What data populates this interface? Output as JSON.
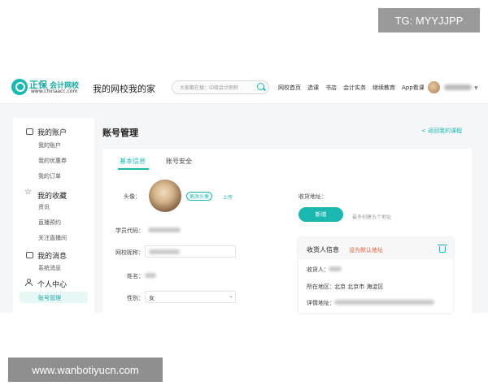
{
  "watermarks": {
    "top": "TG: MYYJJPP",
    "bottom": "www.wanbotiyucn.com"
  },
  "header": {
    "logo_brand": "正保",
    "logo_name": "会计网校",
    "logo_url": "www.chinaacc.com",
    "site_title": "我的网校我的家",
    "search_placeholder": "大家都在搜：中级会计职称",
    "nav": [
      "网校首页",
      "选课",
      "书店",
      "会计实务",
      "继续教育",
      "App看课"
    ]
  },
  "sidebar": {
    "sections": [
      {
        "title": "我的账户",
        "icon": "wallet-icon",
        "items": [
          "我的账户",
          "我的优惠券",
          "我的订单"
        ]
      },
      {
        "title": "我的收藏",
        "icon": "star-icon",
        "items": [
          "资讯",
          "直播预约",
          "关注直播间"
        ]
      },
      {
        "title": "我的消息",
        "icon": "message-icon",
        "items": [
          "系统消息"
        ]
      },
      {
        "title": "个人中心",
        "icon": "user-icon",
        "items": [
          "账号管理"
        ]
      }
    ]
  },
  "main": {
    "title": "账号管理",
    "back_link": "< 返回我的课程",
    "tabs": [
      "基本信息",
      "账号安全"
    ],
    "form": {
      "avatar_label": "头像：",
      "change_avatar": "更改头像",
      "upload": "上传",
      "student_code_label": "学员代码：",
      "nickname_label": "网校昵称：",
      "name_label": "姓名：",
      "gender_label": "性别：",
      "gender_value": "女"
    },
    "shipping": {
      "label": "收货地址：",
      "new_button": "新增",
      "hint": "最多创建五个地址",
      "card_title": "收货人信息",
      "set_default": "设为默认地址",
      "receiver_label": "收货人：",
      "region_label": "所在地区：",
      "region_value": "北京 北京市 海淀区",
      "detail_label": "详情地址："
    }
  }
}
